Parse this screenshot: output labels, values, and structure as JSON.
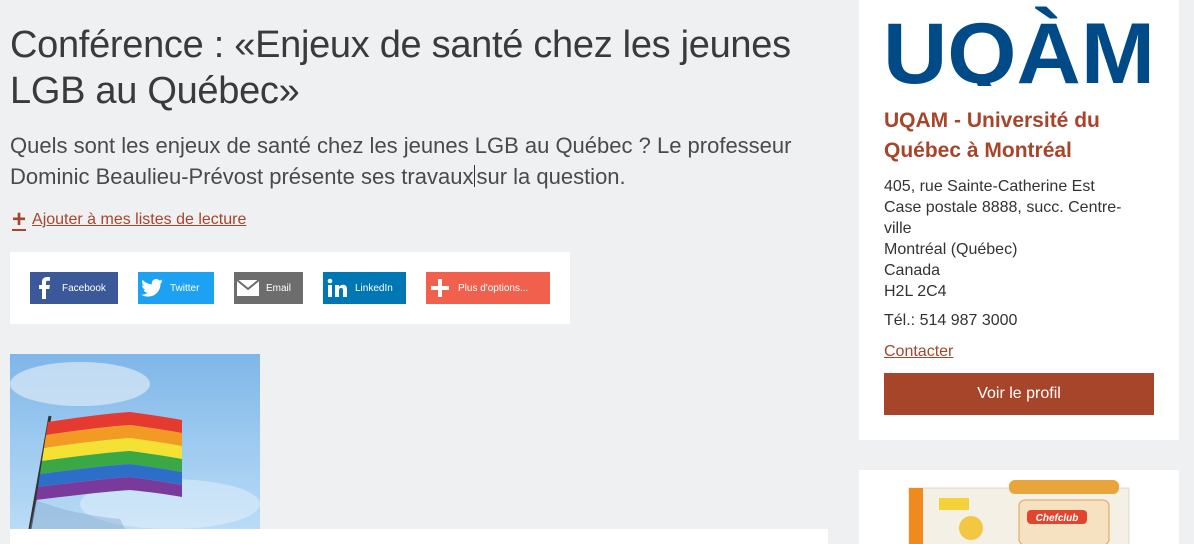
{
  "article": {
    "title": "Conférence : «Enjeux de santé chez les jeunes LGB au Québec»",
    "lead_part1": "Quels sont les enjeux de santé chez les jeunes LGB au Québec ? Le professeur Dominic Beaulieu-Prévost présente ses travaux",
    "lead_part2": "sur la question.",
    "reading_list_label": "Ajouter à mes listes de lecture",
    "reading_list_icon": "+"
  },
  "share": {
    "facebook": "Facebook",
    "twitter": "Twitter",
    "email": "Email",
    "linkedin": "LinkedIn",
    "more": "Plus d'options...",
    "colors": {
      "facebook": "#3b5998",
      "twitter": "#1da1f2",
      "email": "#6d6d6d",
      "linkedin": "#0077b5",
      "more": "#f0604d"
    }
  },
  "sidebar": {
    "logo_text": "UQÀM",
    "org_name": "UQAM - Université du Québec à Montréal",
    "address_lines": [
      "405, rue Sainte-Catherine Est",
      "Case postale 8888, succ. Centre-ville",
      "Montréal (Québec)",
      "Canada",
      "H2L 2C4"
    ],
    "phone": "Tél.: 514 987 3000",
    "contact_label": "Contacter",
    "profile_button": "Voir le profil",
    "accent_color": "#a7452b",
    "logo_color": "#004b87"
  },
  "ad": {
    "brand": "Chefclub"
  }
}
